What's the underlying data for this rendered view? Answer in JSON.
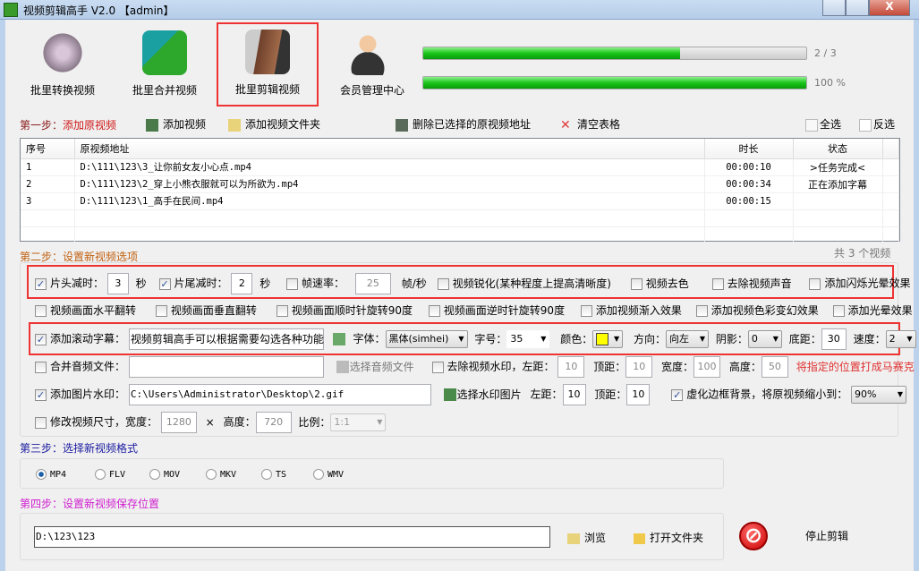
{
  "window": {
    "title": "视频剪辑高手 V2.0 【admin】",
    "close": "X"
  },
  "toolbar": [
    {
      "label": "批里转换视频"
    },
    {
      "label": "批里合并视频"
    },
    {
      "label": "批里剪辑视频"
    },
    {
      "label": "会员管理中心"
    }
  ],
  "progress": {
    "count_text": "2 / 3",
    "count_fraction": 0.67,
    "percent_text": "100 %",
    "percent": 100
  },
  "step1": {
    "label_prefix": "第一步：",
    "label": "添加原视频",
    "add_video": "添加视频",
    "add_folder": "添加视频文件夹",
    "delete_selected": "删除已选择的原视频地址",
    "clear": "清空表格",
    "select_all": "全选",
    "invert": "反选"
  },
  "table": {
    "headers": [
      "序号",
      "原视频地址",
      "时长",
      "状态"
    ],
    "rows": [
      {
        "no": "1",
        "path": "D:\\111\\123\\3_让你前女友小心点.mp4",
        "duration": "00:00:10",
        "status": ">任务完成<"
      },
      {
        "no": "2",
        "path": "D:\\111\\123\\2_穿上小熊衣服就可以为所欲为.mp4",
        "duration": "00:00:34",
        "status": "正在添加字幕"
      },
      {
        "no": "3",
        "path": "D:\\111\\123\\1_高手在民间.mp4",
        "duration": "00:00:15",
        "status": ""
      }
    ],
    "count": "共 3 个视频"
  },
  "step2": {
    "label": "第二步：设置新视频选项",
    "trim_head": {
      "label": "片头减时：",
      "value": "3",
      "unit": "秒",
      "checked": true
    },
    "trim_tail": {
      "label": "片尾减时：",
      "value": "2",
      "unit": "秒",
      "checked": true
    },
    "fps": {
      "label": "帧速率：",
      "value": "25",
      "unit": "帧/秒",
      "checked": false
    },
    "sharpen": "视频锐化(某种程度上提高清晰度)",
    "decolor": "视频去色",
    "mute": "去除视频声音",
    "flash": "添加闪烁光晕效果",
    "hflip": "视频画面水平翻转",
    "vflip": "视频画面垂直翻转",
    "rot_cw": "视频画面顺时针旋转90度",
    "rot_ccw": "视频画面逆时针旋转90度",
    "fade_in": "添加视频渐入效果",
    "color_fx": "添加视频色彩变幻效果",
    "glow": "添加光晕效果",
    "subtitle": {
      "label": "添加滚动字幕：",
      "text": "视频剪辑高手可以根据需要勾选各种功能",
      "font_label": "字体：",
      "font": "黑体(simhei)",
      "size_label": "字号：",
      "size": "35",
      "color_label": "颜色：",
      "color": "#ffff00",
      "dir_label": "方向：",
      "dir": "向左",
      "shadow_label": "阴影：",
      "shadow": "0",
      "bottom_label": "底距：",
      "bottom": "30",
      "speed_label": "速度：",
      "speed": "2"
    },
    "audio": {
      "label": "合并音频文件：",
      "value": "",
      "button": "选择音频文件"
    },
    "remove_wm": {
      "label": "去除视频水印，左距：",
      "left": "10",
      "top_label": "顶距：",
      "top": "10",
      "width_label": "宽度：",
      "width": "100",
      "height_label": "高度：",
      "height": "50",
      "note": "将指定的位置打成马赛克"
    },
    "img_wm": {
      "label": "添加图片水印：",
      "path": "C:\\Users\\Administrator\\Desktop\\2.gif",
      "button": "选择水印图片",
      "left_label": "左距：",
      "left": "10",
      "top_label": "顶距：",
      "top": "10"
    },
    "blur_bg": {
      "label": "虚化边框背景，将原视频缩小到：",
      "value": "90%"
    },
    "resize": {
      "label": "修改视频尺寸，宽度：",
      "width": "1280",
      "x": "×",
      "height_label": "高度：",
      "height": "720",
      "ratio_label": "比例：",
      "ratio": "1:1"
    }
  },
  "step3": {
    "label": "第三步：选择新视频格式",
    "formats": [
      "MP4",
      "FLV",
      "MOV",
      "MKV",
      "TS",
      "WMV"
    ],
    "selected": "MP4"
  },
  "step4": {
    "label": "第四步：设置新视频保存位置",
    "path": "D:\\123\\123",
    "browse": "浏览",
    "open_folder": "打开文件夹",
    "stop": "停止剪辑"
  }
}
